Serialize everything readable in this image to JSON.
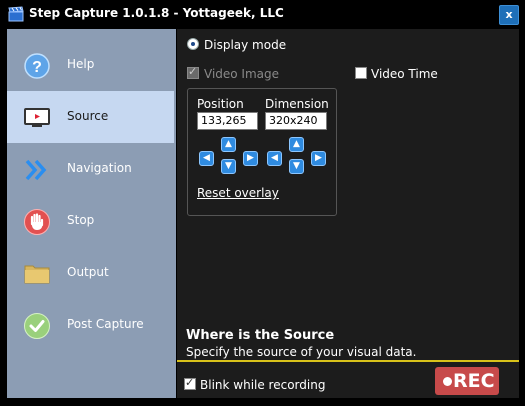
{
  "window": {
    "title": "Step Capture 1.0.1.8 - Yottageek, LLC",
    "close_label": "x"
  },
  "sidebar": {
    "items": [
      {
        "label": "Help",
        "icon": "help-icon"
      },
      {
        "label": "Source",
        "icon": "monitor-icon",
        "selected": true
      },
      {
        "label": "Navigation",
        "icon": "chevron-right-double-icon"
      },
      {
        "label": "Stop",
        "icon": "stop-hand-icon"
      },
      {
        "label": "Output",
        "icon": "folder-icon"
      },
      {
        "label": "Post Capture",
        "icon": "checkmark-icon"
      }
    ]
  },
  "main": {
    "display_mode_label": "Display mode",
    "video_image_label": "Video Image",
    "video_time_label": "Video Time",
    "position_label": "Position",
    "position_value": "133,265",
    "dimension_label": "Dimension",
    "dimension_value": "320x240",
    "reset_overlay_label": "Reset overlay",
    "where_title": "Where is the Source",
    "where_desc": "Specify the source of your visual data.",
    "blink_label": "Blink while recording",
    "rec_label": "REC"
  },
  "colors": {
    "accent_blue": "#2f8be0",
    "divider_yellow": "#d8c21a",
    "rec_red": "#c74a4a",
    "sidebar_bg": "#8c9db4",
    "sidebar_selected": "#c6d8f1"
  }
}
